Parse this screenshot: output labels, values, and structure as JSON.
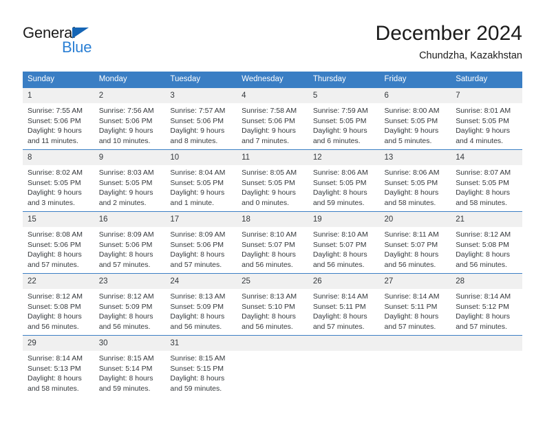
{
  "brand": {
    "name_part1": "General",
    "name_part2": "Blue",
    "triangle_color": "#1565b5",
    "blue_color": "#2a7fd4"
  },
  "header": {
    "title": "December 2024",
    "subtitle": "Chundzha, Kazakhstan"
  },
  "theme": {
    "header_bg": "#3a7ec4",
    "daynum_bg": "#f0f0f0",
    "grid_line": "#3a7ec4",
    "text": "#33373b"
  },
  "calendar": {
    "weekday_headers": [
      "Sunday",
      "Monday",
      "Tuesday",
      "Wednesday",
      "Thursday",
      "Friday",
      "Saturday"
    ],
    "weeks": [
      [
        {
          "day": "1",
          "sunrise": "Sunrise: 7:55 AM",
          "sunset": "Sunset: 5:06 PM",
          "daylight": "Daylight: 9 hours and 11 minutes."
        },
        {
          "day": "2",
          "sunrise": "Sunrise: 7:56 AM",
          "sunset": "Sunset: 5:06 PM",
          "daylight": "Daylight: 9 hours and 10 minutes."
        },
        {
          "day": "3",
          "sunrise": "Sunrise: 7:57 AM",
          "sunset": "Sunset: 5:06 PM",
          "daylight": "Daylight: 9 hours and 8 minutes."
        },
        {
          "day": "4",
          "sunrise": "Sunrise: 7:58 AM",
          "sunset": "Sunset: 5:06 PM",
          "daylight": "Daylight: 9 hours and 7 minutes."
        },
        {
          "day": "5",
          "sunrise": "Sunrise: 7:59 AM",
          "sunset": "Sunset: 5:05 PM",
          "daylight": "Daylight: 9 hours and 6 minutes."
        },
        {
          "day": "6",
          "sunrise": "Sunrise: 8:00 AM",
          "sunset": "Sunset: 5:05 PM",
          "daylight": "Daylight: 9 hours and 5 minutes."
        },
        {
          "day": "7",
          "sunrise": "Sunrise: 8:01 AM",
          "sunset": "Sunset: 5:05 PM",
          "daylight": "Daylight: 9 hours and 4 minutes."
        }
      ],
      [
        {
          "day": "8",
          "sunrise": "Sunrise: 8:02 AM",
          "sunset": "Sunset: 5:05 PM",
          "daylight": "Daylight: 9 hours and 3 minutes."
        },
        {
          "day": "9",
          "sunrise": "Sunrise: 8:03 AM",
          "sunset": "Sunset: 5:05 PM",
          "daylight": "Daylight: 9 hours and 2 minutes."
        },
        {
          "day": "10",
          "sunrise": "Sunrise: 8:04 AM",
          "sunset": "Sunset: 5:05 PM",
          "daylight": "Daylight: 9 hours and 1 minute."
        },
        {
          "day": "11",
          "sunrise": "Sunrise: 8:05 AM",
          "sunset": "Sunset: 5:05 PM",
          "daylight": "Daylight: 9 hours and 0 minutes."
        },
        {
          "day": "12",
          "sunrise": "Sunrise: 8:06 AM",
          "sunset": "Sunset: 5:05 PM",
          "daylight": "Daylight: 8 hours and 59 minutes."
        },
        {
          "day": "13",
          "sunrise": "Sunrise: 8:06 AM",
          "sunset": "Sunset: 5:05 PM",
          "daylight": "Daylight: 8 hours and 58 minutes."
        },
        {
          "day": "14",
          "sunrise": "Sunrise: 8:07 AM",
          "sunset": "Sunset: 5:05 PM",
          "daylight": "Daylight: 8 hours and 58 minutes."
        }
      ],
      [
        {
          "day": "15",
          "sunrise": "Sunrise: 8:08 AM",
          "sunset": "Sunset: 5:06 PM",
          "daylight": "Daylight: 8 hours and 57 minutes."
        },
        {
          "day": "16",
          "sunrise": "Sunrise: 8:09 AM",
          "sunset": "Sunset: 5:06 PM",
          "daylight": "Daylight: 8 hours and 57 minutes."
        },
        {
          "day": "17",
          "sunrise": "Sunrise: 8:09 AM",
          "sunset": "Sunset: 5:06 PM",
          "daylight": "Daylight: 8 hours and 57 minutes."
        },
        {
          "day": "18",
          "sunrise": "Sunrise: 8:10 AM",
          "sunset": "Sunset: 5:07 PM",
          "daylight": "Daylight: 8 hours and 56 minutes."
        },
        {
          "day": "19",
          "sunrise": "Sunrise: 8:10 AM",
          "sunset": "Sunset: 5:07 PM",
          "daylight": "Daylight: 8 hours and 56 minutes."
        },
        {
          "day": "20",
          "sunrise": "Sunrise: 8:11 AM",
          "sunset": "Sunset: 5:07 PM",
          "daylight": "Daylight: 8 hours and 56 minutes."
        },
        {
          "day": "21",
          "sunrise": "Sunrise: 8:12 AM",
          "sunset": "Sunset: 5:08 PM",
          "daylight": "Daylight: 8 hours and 56 minutes."
        }
      ],
      [
        {
          "day": "22",
          "sunrise": "Sunrise: 8:12 AM",
          "sunset": "Sunset: 5:08 PM",
          "daylight": "Daylight: 8 hours and 56 minutes."
        },
        {
          "day": "23",
          "sunrise": "Sunrise: 8:12 AM",
          "sunset": "Sunset: 5:09 PM",
          "daylight": "Daylight: 8 hours and 56 minutes."
        },
        {
          "day": "24",
          "sunrise": "Sunrise: 8:13 AM",
          "sunset": "Sunset: 5:09 PM",
          "daylight": "Daylight: 8 hours and 56 minutes."
        },
        {
          "day": "25",
          "sunrise": "Sunrise: 8:13 AM",
          "sunset": "Sunset: 5:10 PM",
          "daylight": "Daylight: 8 hours and 56 minutes."
        },
        {
          "day": "26",
          "sunrise": "Sunrise: 8:14 AM",
          "sunset": "Sunset: 5:11 PM",
          "daylight": "Daylight: 8 hours and 57 minutes."
        },
        {
          "day": "27",
          "sunrise": "Sunrise: 8:14 AM",
          "sunset": "Sunset: 5:11 PM",
          "daylight": "Daylight: 8 hours and 57 minutes."
        },
        {
          "day": "28",
          "sunrise": "Sunrise: 8:14 AM",
          "sunset": "Sunset: 5:12 PM",
          "daylight": "Daylight: 8 hours and 57 minutes."
        }
      ],
      [
        {
          "day": "29",
          "sunrise": "Sunrise: 8:14 AM",
          "sunset": "Sunset: 5:13 PM",
          "daylight": "Daylight: 8 hours and 58 minutes."
        },
        {
          "day": "30",
          "sunrise": "Sunrise: 8:15 AM",
          "sunset": "Sunset: 5:14 PM",
          "daylight": "Daylight: 8 hours and 59 minutes."
        },
        {
          "day": "31",
          "sunrise": "Sunrise: 8:15 AM",
          "sunset": "Sunset: 5:15 PM",
          "daylight": "Daylight: 8 hours and 59 minutes."
        },
        {
          "day": "",
          "sunrise": "",
          "sunset": "",
          "daylight": ""
        },
        {
          "day": "",
          "sunrise": "",
          "sunset": "",
          "daylight": ""
        },
        {
          "day": "",
          "sunrise": "",
          "sunset": "",
          "daylight": ""
        },
        {
          "day": "",
          "sunrise": "",
          "sunset": "",
          "daylight": ""
        }
      ]
    ]
  }
}
